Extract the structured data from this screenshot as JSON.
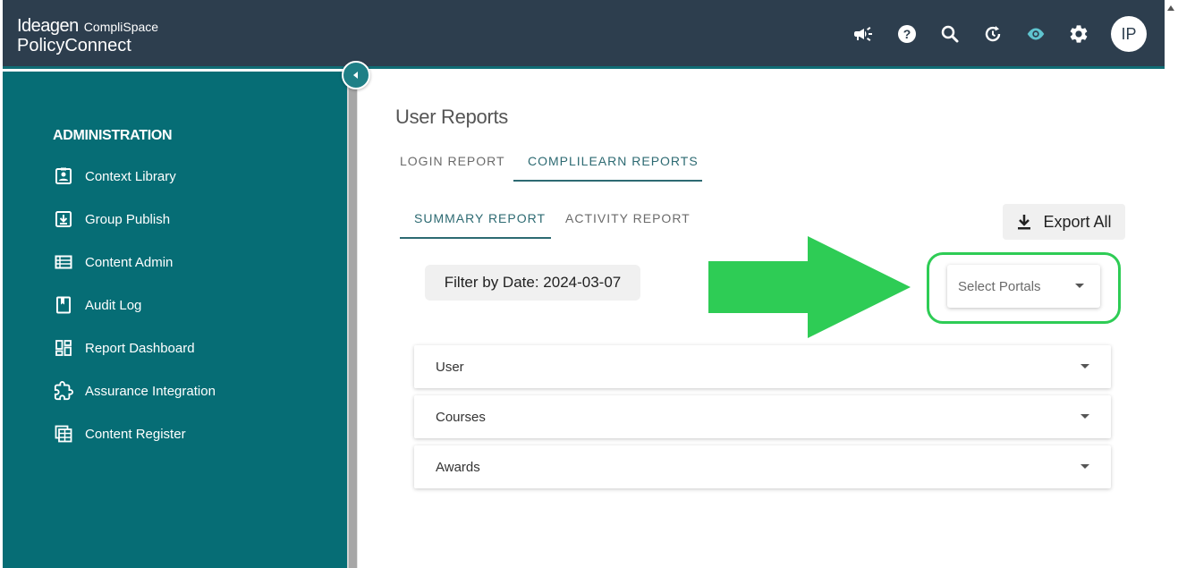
{
  "header": {
    "logo_brand": "Ideagen",
    "logo_sub": "CompliSpace",
    "logo_product": "PolicyConnect",
    "icons": [
      "megaphone-icon",
      "help-icon",
      "search-icon",
      "history-icon",
      "eye-icon",
      "gear-icon"
    ],
    "avatar_initials": "IP"
  },
  "sidebar": {
    "section_title": "ADMINISTRATION",
    "items": [
      {
        "label": "Context Library",
        "icon": "contact-card-icon"
      },
      {
        "label": "Group Publish",
        "icon": "download-box-icon"
      },
      {
        "label": "Content Admin",
        "icon": "list-icon"
      },
      {
        "label": "Audit Log",
        "icon": "bookmark-icon"
      },
      {
        "label": "Report Dashboard",
        "icon": "dashboard-icon"
      },
      {
        "label": "Assurance Integration",
        "icon": "puzzle-icon"
      },
      {
        "label": "Content Register",
        "icon": "register-icon"
      }
    ]
  },
  "main": {
    "title": "User Reports",
    "tabs": [
      {
        "label": "LOGIN REPORT",
        "active": false
      },
      {
        "label": "COMPLILEARN REPORTS",
        "active": true
      }
    ],
    "subtabs": [
      {
        "label": "SUMMARY REPORT",
        "active": true
      },
      {
        "label": "ACTIVITY REPORT",
        "active": false
      }
    ],
    "export_label": "Export All",
    "filter_label": "Filter by Date: 2024-03-07",
    "select_placeholder": "Select Portals",
    "accordions": [
      "User",
      "Courses",
      "Awards"
    ]
  },
  "colors": {
    "header_bg": "#2d3e4e",
    "sidebar_bg": "#066d75",
    "accent": "#2d6a72",
    "annotation_green": "#2ecc55"
  }
}
